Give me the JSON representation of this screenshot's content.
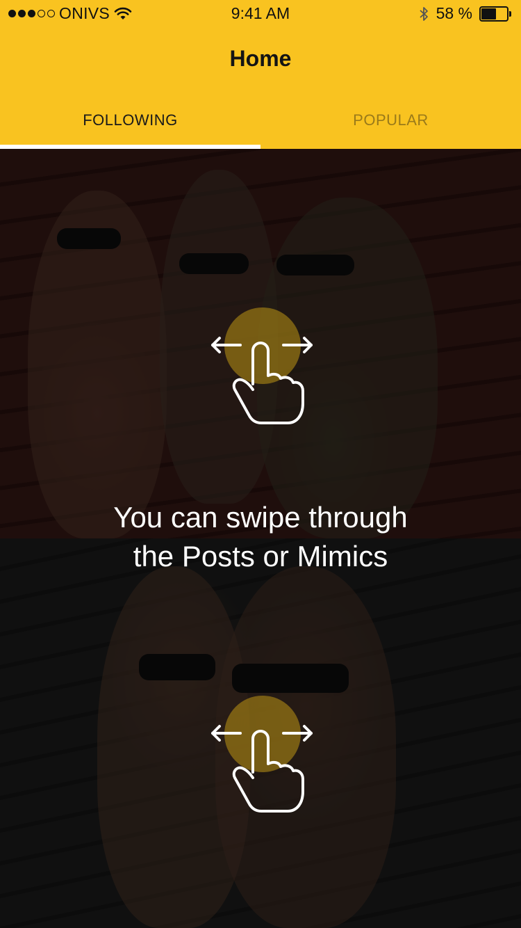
{
  "status_bar": {
    "carrier": "ONIVS",
    "time": "9:41 AM",
    "battery_text": "58 %",
    "battery_level": 0.58,
    "signal_dots_filled": 3,
    "signal_dots_total": 5
  },
  "header": {
    "title": "Home",
    "background_color": "#F9C320"
  },
  "tabs": [
    {
      "label": "FOLLOWING",
      "active": true
    },
    {
      "label": "POPULAR",
      "active": false
    }
  ],
  "feed": {
    "hint_line1": "You can swipe through",
    "hint_line2": "the Posts or Mimics",
    "icons": [
      "swipe-gesture-icon",
      "play-icon"
    ]
  }
}
